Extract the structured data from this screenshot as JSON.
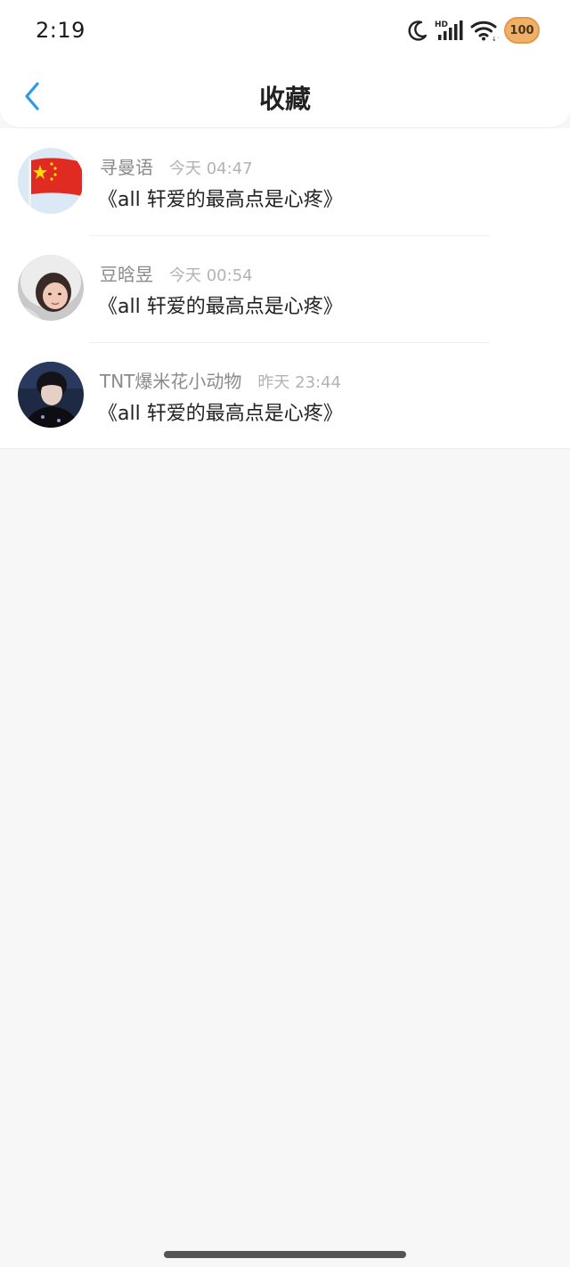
{
  "status_bar": {
    "time": "2:19",
    "icons": [
      "moon-icon",
      "hd-signal-icon",
      "wifi-icon",
      "battery-icon"
    ],
    "battery_level": "100"
  },
  "header": {
    "title": "收藏",
    "back_icon": "chevron-left-icon"
  },
  "favorites": [
    {
      "name": "寻曼语",
      "date": "今天 04:47",
      "title": "《all 轩爱的最高点是心疼》",
      "avatar": "china-flag-avatar"
    },
    {
      "name": "豆晗昱",
      "date": "今天 00:54",
      "title": "《all 轩爱的最高点是心疼》",
      "avatar": "hooded-girl-avatar"
    },
    {
      "name": "TNT爆米花小动物",
      "date": "昨天 23:44",
      "title": "《all 轩爱的最高点是心疼》",
      "avatar": "portrait-avatar"
    }
  ],
  "colors": {
    "accent": "#2b9ae8",
    "background": "#f8f7f8",
    "name_text": "#8a8a8a",
    "date_text": "#b3b3b3",
    "battery": "#f0b067"
  }
}
